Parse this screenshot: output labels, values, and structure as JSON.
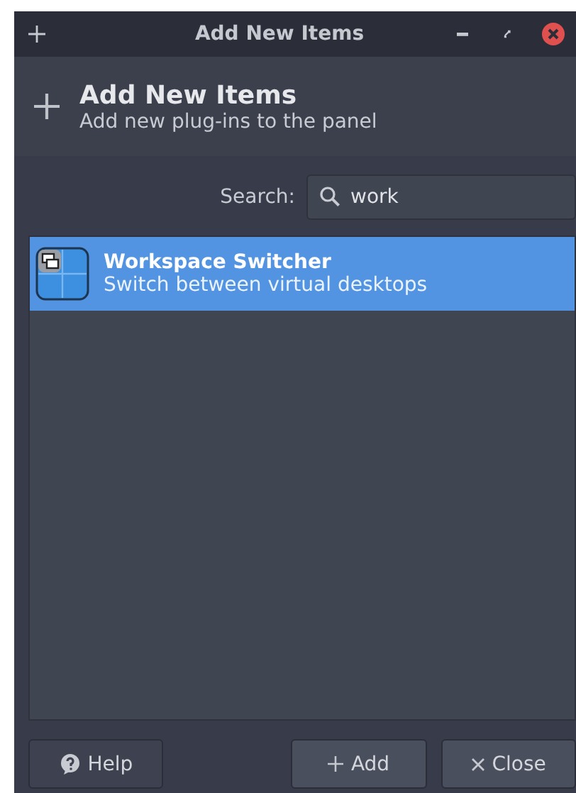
{
  "window": {
    "title": "Add New Items"
  },
  "header": {
    "title": "Add New Items",
    "subtitle": "Add new plug-ins to the panel"
  },
  "search": {
    "label": "Search:",
    "value": "work"
  },
  "items": [
    {
      "name": "Workspace Switcher",
      "description": "Switch between virtual desktops",
      "selected": true
    }
  ],
  "buttons": [
    {
      "kind": "help",
      "label": "Help"
    },
    {
      "kind": "add",
      "label": "Add"
    },
    {
      "kind": "close",
      "label": "Close"
    }
  ]
}
